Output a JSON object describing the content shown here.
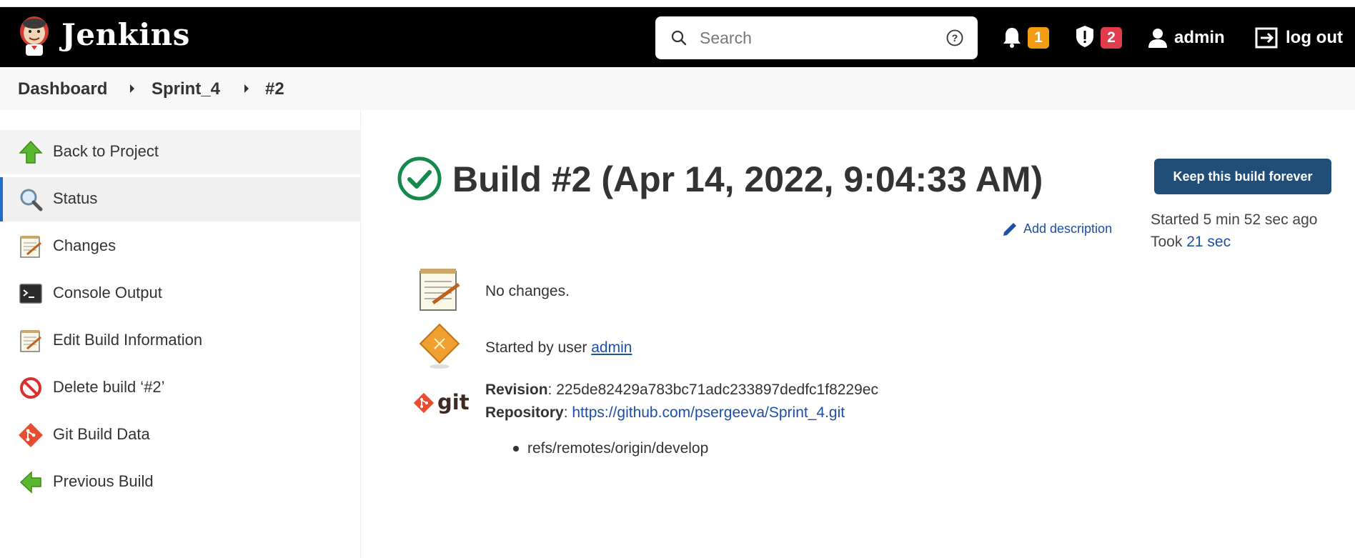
{
  "header": {
    "brand": "Jenkins",
    "search": {
      "placeholder": "Search"
    },
    "notifications_count": "1",
    "security_count": "2",
    "user": "admin",
    "logout": "log out"
  },
  "breadcrumb": [
    "Dashboard",
    "Sprint_4",
    "#2"
  ],
  "sidebar": {
    "items": [
      {
        "label": "Back to Project",
        "icon": "up-arrow-icon"
      },
      {
        "label": "Status",
        "icon": "magnifier-icon"
      },
      {
        "label": "Changes",
        "icon": "notepad-icon"
      },
      {
        "label": "Console Output",
        "icon": "terminal-icon"
      },
      {
        "label": "Edit Build Information",
        "icon": "notepad-icon"
      },
      {
        "label": "Delete build ‘#2’",
        "icon": "no-entry-icon"
      },
      {
        "label": "Git Build Data",
        "icon": "git-icon"
      },
      {
        "label": "Previous Build",
        "icon": "left-arrow-icon"
      }
    ]
  },
  "build": {
    "title": "Build #2 (Apr 14, 2022, 9:04:33 AM)",
    "keep_button": "Keep this build forever",
    "add_description": "Add description",
    "started_text": "Started 5 min 52 sec ago",
    "took_label": "Took",
    "took_value": "21 sec",
    "changes_text": "No changes.",
    "started_by_label": "Started by user",
    "started_by_user": "admin",
    "revision_label": "Revision",
    "revision_value": "225de82429a783bc71adc233897dedfc1f8229ec",
    "repository_label": "Repository",
    "repository_url": "https://github.com/psergeeva/Sprint_4.git",
    "branches": [
      "refs/remotes/origin/develop"
    ],
    "git_logo_text": "git"
  },
  "colors": {
    "header_bg": "#000000",
    "accent_button": "#1f4e79",
    "link": "#1b4fa8",
    "success": "#138a4c",
    "badge_orange": "#f39c12",
    "badge_red": "#e03c4c"
  }
}
